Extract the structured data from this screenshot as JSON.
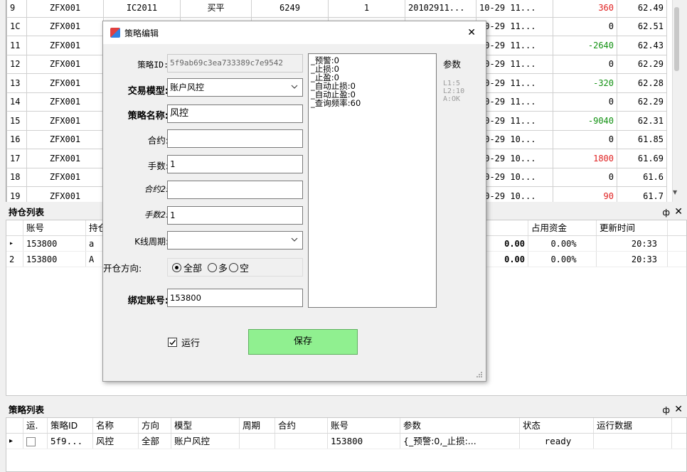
{
  "top_grid": {
    "rows": [
      {
        "idx": "9",
        "code": "ZFX001",
        "contract": "IC2011",
        "action": "买平",
        "price": "6249",
        "qty": "1",
        "order": "20102911...",
        "date": "10-29 11...",
        "pnl": "360",
        "pnl_color": "red",
        "val": "62.49"
      },
      {
        "idx": "1C",
        "code": "ZFX001",
        "date": "10-29 11...",
        "pnl": "0",
        "pnl_color": "black",
        "val": "62.51"
      },
      {
        "idx": "11",
        "code": "ZFX001",
        "date": "10-29 11...",
        "pnl": "-2640",
        "pnl_color": "green",
        "val": "62.43"
      },
      {
        "idx": "12",
        "code": "ZFX001",
        "date": "10-29 11...",
        "pnl": "0",
        "pnl_color": "black",
        "val": "62.29"
      },
      {
        "idx": "13",
        "code": "ZFX001",
        "date": "10-29 11...",
        "pnl": "-320",
        "pnl_color": "green",
        "val": "62.28"
      },
      {
        "idx": "14",
        "code": "ZFX001",
        "date": "10-29 11...",
        "pnl": "0",
        "pnl_color": "black",
        "val": "62.29"
      },
      {
        "idx": "15",
        "code": "ZFX001",
        "date": "10-29 11...",
        "pnl": "-9040",
        "pnl_color": "green",
        "val": "62.31"
      },
      {
        "idx": "16",
        "code": "ZFX001",
        "date": "10-29 10...",
        "pnl": "0",
        "pnl_color": "black",
        "val": "61.85"
      },
      {
        "idx": "17",
        "code": "ZFX001",
        "date": "10-29 10...",
        "pnl": "1800",
        "pnl_color": "red",
        "val": "61.69"
      },
      {
        "idx": "18",
        "code": "ZFX001",
        "date": "10-29 10...",
        "pnl": "0",
        "pnl_color": "black",
        "val": "61.6"
      },
      {
        "idx": "19",
        "code": "ZFX001",
        "date": "10-29 10...",
        "pnl": "90",
        "pnl_color": "red",
        "val": "61.7"
      }
    ]
  },
  "positions": {
    "title": "持仓列表",
    "pin": "ф",
    "close": "✕",
    "headers": [
      "账号",
      "持仓",
      "占用资金",
      "更新时间"
    ],
    "rows": [
      {
        "marker": "▸",
        "account": "153800",
        "partial": "a",
        "amount": "0.00",
        "margin": "0.00%",
        "time": "20:33"
      },
      {
        "marker": "2",
        "account": "153800",
        "partial": "A",
        "amount": "0.00",
        "margin": "0.00%",
        "time": "20:33"
      }
    ]
  },
  "strategies": {
    "title": "策略列表",
    "pin": "ф",
    "close": "✕",
    "headers": [
      "运.",
      "策略ID",
      "名称",
      "方向",
      "模型",
      "周期",
      "合约",
      "账号",
      "参数",
      "状态",
      "运行数据"
    ],
    "rows": [
      {
        "marker": "▸",
        "id": "5f9...",
        "name": "风控",
        "direction": "全部",
        "model": "账户风控",
        "period": "",
        "contract": "",
        "account": "153800",
        "params": "{_预警:0,_止损:...",
        "status": "ready",
        "runtime": ""
      }
    ]
  },
  "dialog": {
    "title": "策略编辑",
    "close": "✕",
    "labels": {
      "id": "策略ID:",
      "model": "交易模型:",
      "name": "策略名称:",
      "contract": "合约:",
      "qty": "手数:",
      "contract2": "合约2:",
      "qty2": "手数2:",
      "kline": "K线周期:",
      "direction": "开仓方向:",
      "account": "绑定账号:",
      "params": "参数"
    },
    "values": {
      "id": "5f9ab69c3ea733389c7e9542",
      "model": "账户风控",
      "name": "风控",
      "contract": "",
      "qty": "1",
      "contract2": "",
      "qty2": "1",
      "kline": "",
      "account": "153800"
    },
    "direction_options": [
      "全部",
      "多",
      "空"
    ],
    "direction_selected": "全部",
    "params_lines": [
      "_预警:0",
      "_止损:0",
      "_止盈:0",
      "_自动止损:0",
      "_自动止盈:0",
      "_查询频率:60"
    ],
    "params_hint": [
      "L1:5",
      "L2:10",
      "A:OK"
    ],
    "run_label": "运行",
    "run_checked": true,
    "save_label": "保存",
    "save_color": "#90f090"
  }
}
